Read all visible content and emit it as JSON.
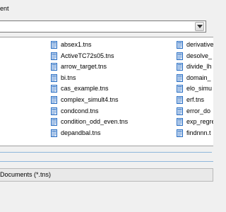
{
  "window": {
    "title_fragment": "ent"
  },
  "path_combo": {
    "value": "",
    "icon": "chevron-down-icon"
  },
  "files": {
    "column1": [
      "absex1.tns",
      "ActiveTC72s05.tns",
      "arrow_target.tns",
      "bi.tns",
      "cas_example.tns",
      "complex_simult4.tns",
      "condcond.tns",
      "condition_odd_even.tns",
      "depandbal.tns"
    ],
    "column2": [
      "derivative",
      "desolve_",
      "divide_lh",
      "domain_",
      "elo_simu",
      "erf.tns",
      "error_do",
      "exp_regre",
      "findnnn.t"
    ],
    "icon": "tns-document-icon"
  },
  "filter": {
    "label": "Documents (*.tns)"
  },
  "colors": {
    "accent": "#8fb7dc",
    "icon_blue": "#2a6fc4"
  }
}
